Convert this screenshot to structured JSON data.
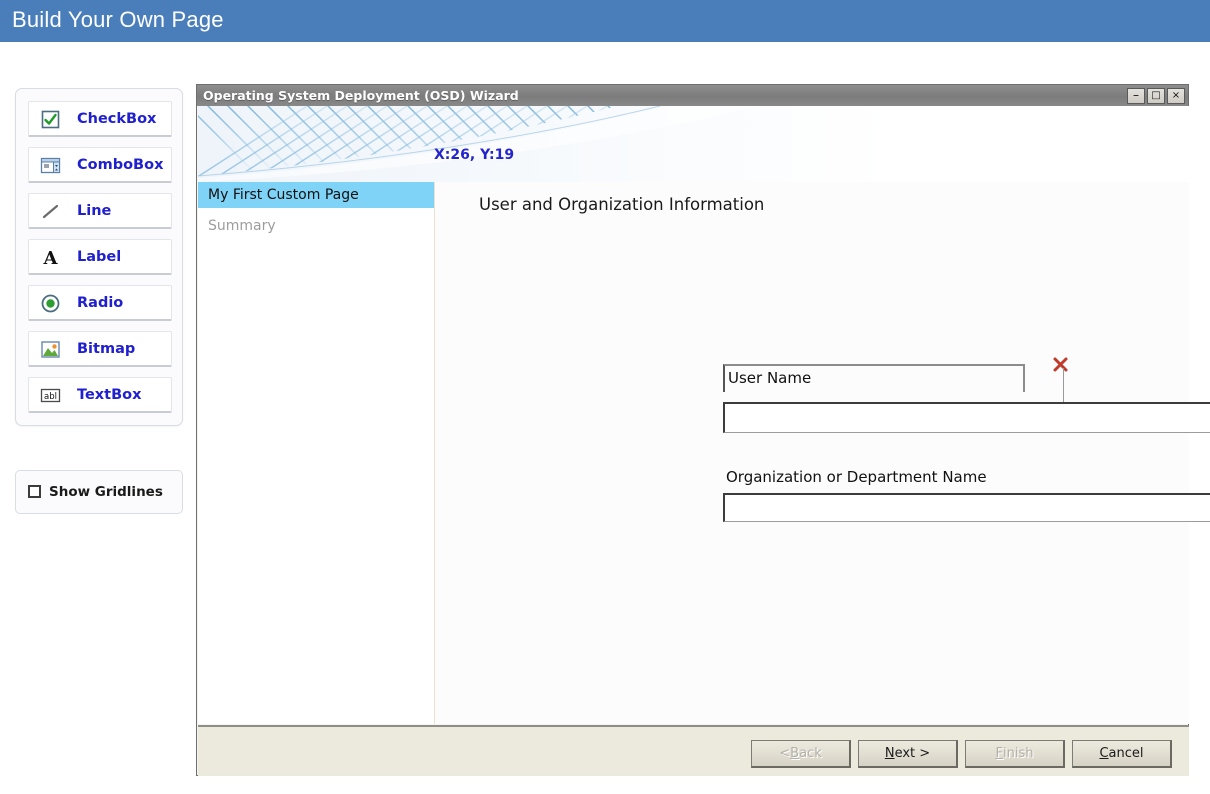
{
  "header": {
    "title": "Build Your Own Page"
  },
  "toolbox": {
    "items": [
      {
        "label": "CheckBox",
        "icon": "checkbox-icon"
      },
      {
        "label": "ComboBox",
        "icon": "combobox-icon"
      },
      {
        "label": "Line",
        "icon": "line-icon"
      },
      {
        "label": "Label",
        "icon": "label-icon"
      },
      {
        "label": "Radio",
        "icon": "radio-icon"
      },
      {
        "label": "Bitmap",
        "icon": "bitmap-icon"
      },
      {
        "label": "TextBox",
        "icon": "textbox-icon"
      }
    ],
    "gridlines": {
      "label": "Show Gridlines",
      "checked": false
    }
  },
  "wizard": {
    "title": "Operating System Deployment (OSD) Wizard",
    "window_buttons": {
      "minimize": "–",
      "maximize": "□",
      "close": "×"
    },
    "coordinates": "X:26, Y:19",
    "nav": {
      "items": [
        {
          "label": "My First Custom Page",
          "selected": true
        },
        {
          "label": "Summary",
          "selected": false
        }
      ]
    },
    "content": {
      "heading": "User and Organization Information",
      "user_name_label": "User Name",
      "user_name_value": "",
      "org_name_label": "Organization or Department Name",
      "org_name_value": ""
    },
    "footer": {
      "back": {
        "label": "< Back",
        "disabled": true
      },
      "next": {
        "label": "Next >",
        "disabled": false,
        "accel": "N"
      },
      "finish": {
        "label": "Finish",
        "disabled": true,
        "accel": "F"
      },
      "cancel": {
        "label": "Cancel",
        "disabled": false,
        "accel": "C"
      }
    }
  },
  "colors": {
    "header_blue": "#4a7ebb",
    "tool_label_blue": "#2020cf",
    "nav_selected": "#7fd3f7",
    "footer_beige": "#ece9dd",
    "coord_blue": "#2424cc",
    "delete_handle_red": "#c0392b"
  }
}
